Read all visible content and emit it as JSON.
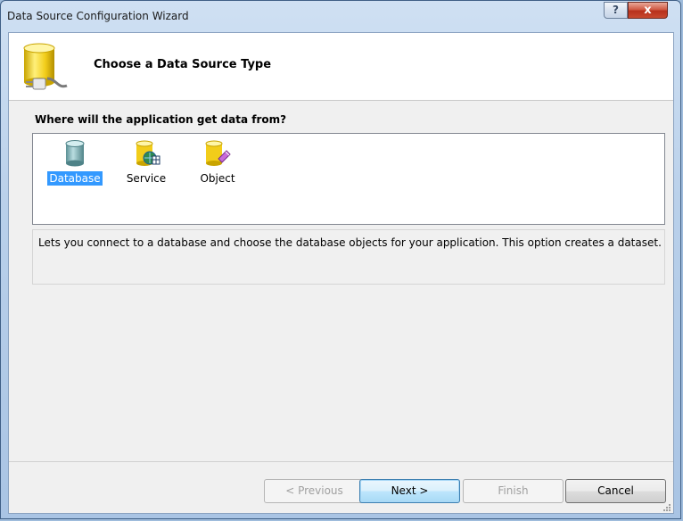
{
  "window": {
    "title": "Data Source Configuration Wizard"
  },
  "titlebar": {
    "help_glyph": "?",
    "close_glyph": "x"
  },
  "header": {
    "title": "Choose a Data Source Type",
    "icon": "database-plug-icon"
  },
  "question": "Where will the application get data from?",
  "sources": [
    {
      "label": "Database",
      "icon": "database-icon",
      "selected": true
    },
    {
      "label": "Service",
      "icon": "service-icon",
      "selected": false
    },
    {
      "label": "Object",
      "icon": "object-icon",
      "selected": false
    }
  ],
  "description": "Lets you connect to a database and choose the database objects for your application. This option creates a dataset.",
  "buttons": {
    "previous": "< Previous",
    "next": "Next >",
    "finish": "Finish",
    "cancel": "Cancel"
  },
  "colors": {
    "selection": "#3399ff",
    "close": "#c8492f"
  }
}
